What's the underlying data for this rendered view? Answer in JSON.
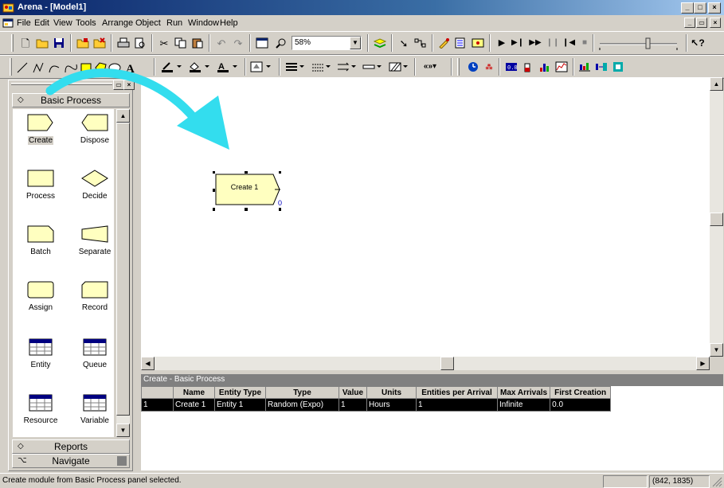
{
  "window": {
    "title": "Arena - [Model1]",
    "min_glyph": "_",
    "max_glyph": "□",
    "close_glyph": "×",
    "mdi_restore_glyph": "▭"
  },
  "menu": {
    "items": [
      {
        "label": "File"
      },
      {
        "label": "Edit"
      },
      {
        "label": "View"
      },
      {
        "label": "Tools"
      },
      {
        "label": "Arrange"
      },
      {
        "label": "Object"
      },
      {
        "label": "Run"
      },
      {
        "label": "Window"
      },
      {
        "label": "Help"
      }
    ]
  },
  "toolbar": {
    "zoom": "58%",
    "combo_arrow": "▼"
  },
  "project_bar": {
    "panel_title": "Basic Process",
    "modules": [
      {
        "label": "Create",
        "icon": "create-shape-icon"
      },
      {
        "label": "Dispose",
        "icon": "dispose-shape-icon"
      },
      {
        "label": "Process",
        "icon": "process-shape-icon"
      },
      {
        "label": "Decide",
        "icon": "decide-shape-icon"
      },
      {
        "label": "Batch",
        "icon": "batch-shape-icon"
      },
      {
        "label": "Separate",
        "icon": "separate-shape-icon"
      },
      {
        "label": "Assign",
        "icon": "assign-shape-icon"
      },
      {
        "label": "Record",
        "icon": "record-shape-icon"
      },
      {
        "label": "Entity",
        "icon": "table-icon"
      },
      {
        "label": "Queue",
        "icon": "table-icon"
      },
      {
        "label": "Resource",
        "icon": "table-icon"
      },
      {
        "label": "Variable",
        "icon": "table-icon"
      }
    ],
    "reports_label": "Reports",
    "navigate_label": "Navigate"
  },
  "canvas": {
    "module_label": "Create 1",
    "module_counter": "0"
  },
  "sheet": {
    "title": "Create - Basic Process",
    "columns": [
      "Name",
      "Entity Type",
      "Type",
      "Value",
      "Units",
      "Entities per Arrival",
      "Max Arrivals",
      "First Creation"
    ],
    "rows": [
      {
        "num": "1",
        "cells": [
          "Create 1",
          "Entity 1",
          "Random (Expo)",
          "1",
          "Hours",
          "1",
          "Infinite",
          "0.0"
        ]
      }
    ]
  },
  "status": {
    "message": "Create module from Basic Process panel selected.",
    "coords": "(842, 1835)"
  },
  "colors": {
    "title_bar": "#0a246a",
    "module_fill": "#ffffc0",
    "arrow": "#33ddee"
  }
}
